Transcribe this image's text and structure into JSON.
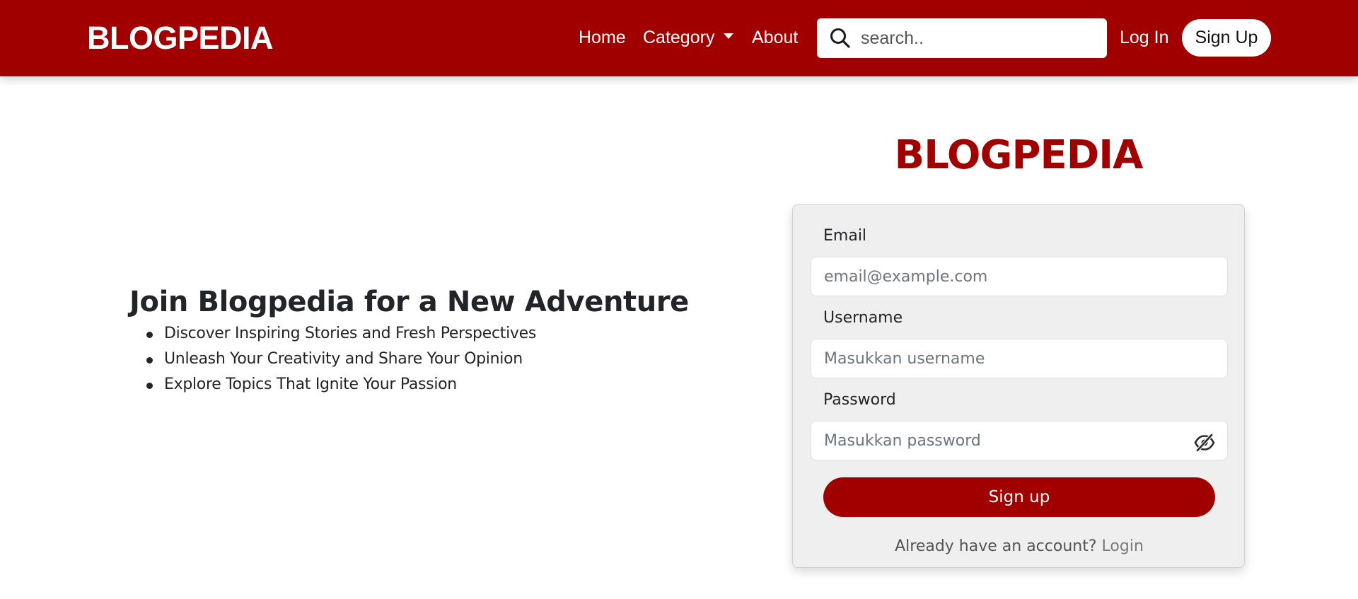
{
  "navbar": {
    "brand": "BLOGPEDIA",
    "links": {
      "home": "Home",
      "category": "Category",
      "about": "About",
      "login": "Log In"
    },
    "search_placeholder": "search..",
    "signup_label": "Sign Up",
    "background_color": "#a00000"
  },
  "hero": {
    "title": "Join Blogpedia for a New Adventure",
    "points": [
      "Discover Inspiring Stories and Fresh Perspectives",
      "Unleash Your Creativity and Share Your Opinion",
      "Explore Topics That Ignite Your Passion"
    ]
  },
  "signup_form": {
    "logo": "BLOGPEDIA",
    "email_label": "Email",
    "email_placeholder": "email@example.com",
    "username_label": "Username",
    "username_placeholder": "Masukkan username",
    "password_label": "Password",
    "password_placeholder": "Masukkan password",
    "password_toggle_icon": "eye-slash-icon",
    "submit_label": "Sign up",
    "account_prompt": "Already have an account?",
    "login_link": "Login",
    "accent_color": "#a00000"
  }
}
